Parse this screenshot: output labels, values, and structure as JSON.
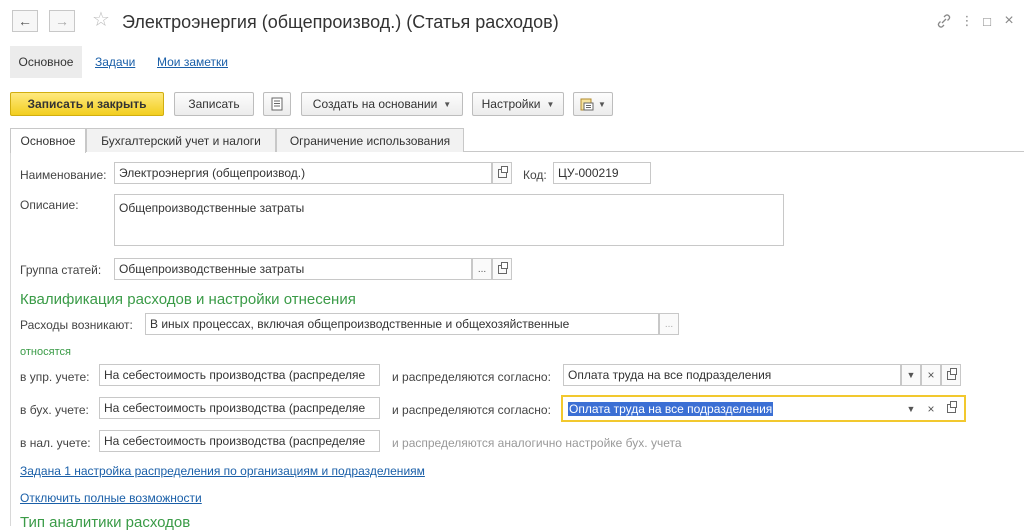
{
  "window": {
    "title": "Электроэнергия (общепроизвод.) (Статья расходов)",
    "back_icon": "←",
    "forward_icon": "→",
    "star_icon": "☆",
    "menu_icon": "⋮",
    "link_icon": "🔗",
    "maximize_icon": "□",
    "close_icon": "×"
  },
  "nav": {
    "main": "Основное",
    "tasks": "Задачи",
    "notes": "Мои заметки"
  },
  "toolbar": {
    "save_close": "Записать и закрыть",
    "save": "Записать",
    "create_based": "Создать на основании",
    "settings": "Настройки"
  },
  "tabs": {
    "main": "Основное",
    "accounting": "Бухгалтерский учет и налоги",
    "restriction": "Ограничение использования"
  },
  "form": {
    "name_label": "Наименование:",
    "name_value": "Электроэнергия (общепроизвод.)",
    "code_label": "Код:",
    "code_value": "ЦУ-000219",
    "description_label": "Описание:",
    "description_value": "Общепроизводственные затраты",
    "group_label": "Группа статей:",
    "group_value": "Общепроизводственные затраты",
    "section_title": "Квалификация расходов и настройки отнесения",
    "expenses_label": "Расходы возникают:",
    "expenses_value": "В иных процессах, включая общепроизводственные и общехозяйственные",
    "relate_label": "относятся",
    "mgmt_label": "в упр. учете:",
    "mgmt_value": "На себестоимость производства (распределяе",
    "mgmt_distr_label": "и распределяются согласно:",
    "mgmt_distr_value": "Оплата труда на все подразделения",
    "acc_label": "в бух. учете:",
    "acc_value": "На себестоимость производства (распределяе",
    "acc_distr_label": "и распределяются согласно:",
    "acc_distr_value": "Оплата труда на все подразделения",
    "tax_label": "в нал. учете:",
    "tax_value": "На себестоимость производства (распределяе",
    "tax_note": "и распределяются аналогично настройке бух. учета",
    "link_distribution": "Задана 1 настройка распределения по организациям и подразделениям",
    "link_disable": "Отключить полные возможности",
    "section_analytics": "Тип аналитики расходов"
  }
}
